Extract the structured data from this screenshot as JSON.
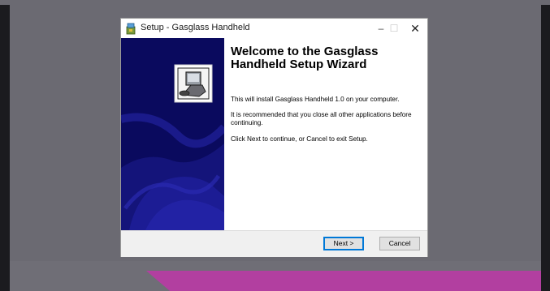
{
  "window": {
    "title": "Setup - Gasglass Handheld",
    "controls": {
      "minimize": "–",
      "maximize": "☐",
      "close": "✕"
    }
  },
  "content": {
    "heading": "Welcome to the Gasglass Handheld Setup Wizard",
    "paragraphs": [
      "This will install Gasglass Handheld 1.0 on your computer.",
      "It is recommended that you close all other applications before continuing.",
      "Click Next to continue, or Cancel to exit Setup."
    ]
  },
  "footer": {
    "next_label": "Next >",
    "cancel_label": "Cancel"
  },
  "icons": {
    "app": "setup-box-icon",
    "banner": "installer-computer-icon"
  },
  "colors": {
    "banner": "#0a0a5e",
    "backdrop": "#6b6a72",
    "accent": "#0078d7",
    "magenta": "#b23fa0"
  }
}
